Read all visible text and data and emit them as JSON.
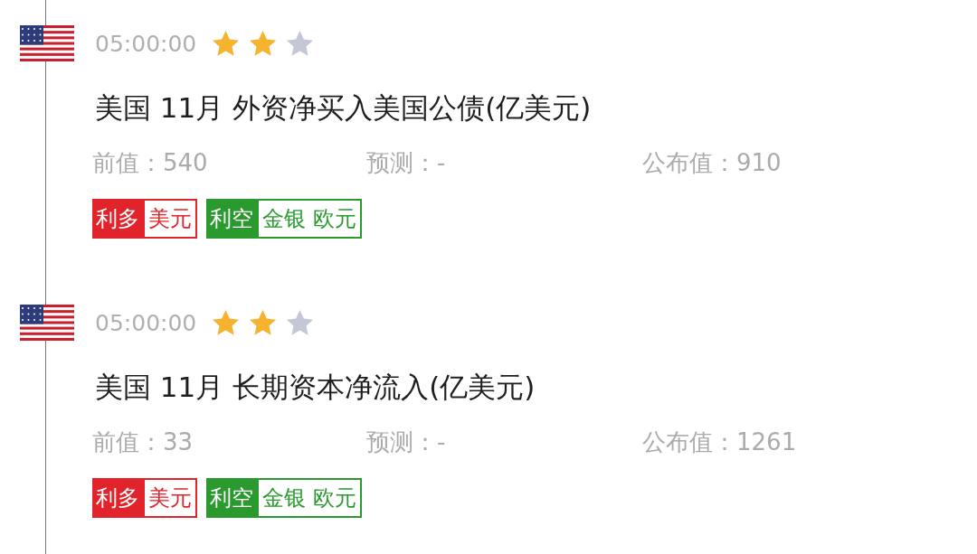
{
  "events": [
    {
      "time": "05:00:00",
      "stars": 2,
      "title": "美国 11月 外资净买入美国公债(亿美元)",
      "fields": [
        "前值：540",
        "预测：-",
        "公布值：910"
      ],
      "tags": [
        {
          "label": "利多",
          "items": [
            "美元"
          ],
          "color": "#e1232b"
        },
        {
          "label": "利空",
          "items": [
            "金银",
            "欧元"
          ],
          "color": "#2a9a2f"
        }
      ]
    },
    {
      "time": "05:00:00",
      "stars": 2,
      "title": "美国 11月 长期资本净流入(亿美元)",
      "fields": [
        "前值：33",
        "预测：-",
        "公布值：1261"
      ],
      "tags": [
        {
          "label": "利多",
          "items": [
            "美元"
          ],
          "color": "#e1232b"
        },
        {
          "label": "利空",
          "items": [
            "金银",
            "欧元"
          ],
          "color": "#2a9a2f"
        }
      ]
    }
  ]
}
